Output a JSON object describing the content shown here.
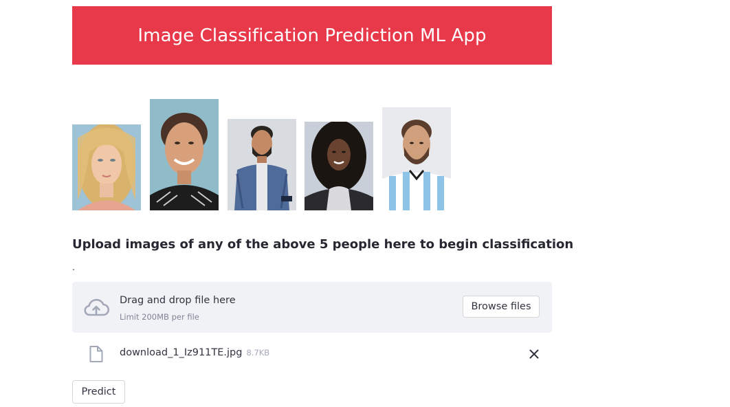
{
  "app": {
    "title": "Image Classification Prediction ML App",
    "accent_color": "#e8394a"
  },
  "gallery": {
    "images": [
      {
        "name": "person-1-photo",
        "description": "blonde woman portrait"
      },
      {
        "name": "person-2-photo",
        "description": "smiling man with curly hair"
      },
      {
        "name": "person-3-photo",
        "description": "bearded man in blue jacket"
      },
      {
        "name": "person-4-photo",
        "description": "woman with long curly dark hair"
      },
      {
        "name": "person-5-photo",
        "description": "bearded man in striped jersey"
      }
    ]
  },
  "upload": {
    "heading": "Upload images of any of the above 5 people here to begin classification",
    "caption": ".",
    "dropzone_title": "Drag and drop file here",
    "dropzone_limit": "Limit 200MB per file",
    "browse_label": "Browse files"
  },
  "uploaded_file": {
    "name": "download_1_Iz911TE.jpg",
    "size": "8.7KB"
  },
  "actions": {
    "predict_label": "Predict"
  }
}
